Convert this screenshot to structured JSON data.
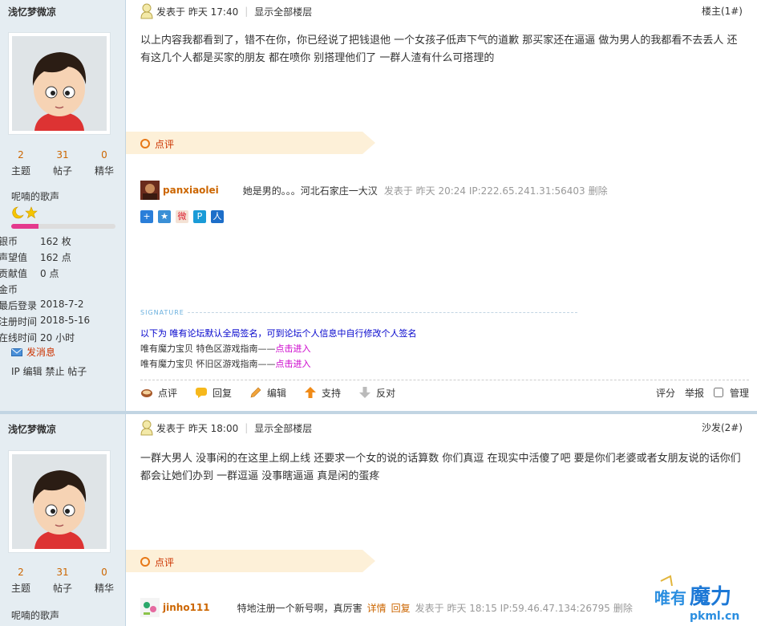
{
  "posts": [
    {
      "username": "浅忆梦微凉",
      "stats": [
        {
          "n": "2",
          "l": "主题"
        },
        {
          "n": "31",
          "l": "帖子"
        },
        {
          "n": "0",
          "l": "精华"
        }
      ],
      "group": "呢喃的歌声",
      "level_fill": 0.26,
      "profile": [
        {
          "k": "银币",
          "v": "162 枚"
        },
        {
          "k": "声望值",
          "v": "162 点"
        },
        {
          "k": "贡献值",
          "v": "0 点"
        },
        {
          "k": "金币",
          "v": ""
        },
        {
          "k": "最后登录",
          "v": "2018-7-2"
        },
        {
          "k": "注册时间",
          "v": "2018-5-16"
        },
        {
          "k": "在线时间",
          "v": "20 小时"
        }
      ],
      "pm": "发消息",
      "admin": [
        "IP",
        "编辑",
        "禁止",
        "帖子"
      ],
      "posted": "发表于 昨天 17:40",
      "show_all": "显示全部楼层",
      "floor": "楼主(1#)",
      "content": "以上内容我都看到了，错不在你，你已经说了把钱退他 一个女孩子低声下气的道歉 那买家还在逼逼 做为男人的我都看不去丢人 还有这几个人都是买家的朋友 都在喷你 别搭理他们了 一群人渣有什么可搭理的",
      "comment_label": "点评",
      "comment": {
        "user": "panxiaolei",
        "text": "她是男的。。。河北石家庄一大汉",
        "meta": "发表于 昨天 20:24 IP:222.65.241.31:56403",
        "del": "删除"
      },
      "signature_label": "SIGNATURE",
      "sig1_pre": "以下为",
      "sig1_rest": "唯有论坛默认全局签名，可到论坛个人信息中自行修改个人签名",
      "sig2": "唯有魔力宝贝 特色区游戏指南——",
      "sig3": "唯有魔力宝贝 怀旧区游戏指南——",
      "sig_link": "点击进入",
      "actions": [
        "点评",
        "回复",
        "编辑",
        "支持",
        "反对"
      ],
      "actions_right": [
        "评分",
        "举报",
        "管理"
      ]
    },
    {
      "username": "浅忆梦微凉",
      "stats": [
        {
          "n": "2",
          "l": "主题"
        },
        {
          "n": "31",
          "l": "帖子"
        },
        {
          "n": "0",
          "l": "精华"
        }
      ],
      "group": "呢喃的歌声",
      "posted": "发表于 昨天 18:00",
      "show_all": "显示全部楼层",
      "floor": "沙发(2#)",
      "content": "一群大男人 没事闲的在这里上纲上线 还要求一个女的说的话算数 你们真逗 在现实中活傻了吧 要是你们老婆或者女朋友说的话你们都会让她们办到 一群逗逼 没事瞎逼逼 真是闲的蛋疼",
      "comment_label": "点评",
      "comment": {
        "user": "jinho111",
        "text": "特地注册一个新号啊，真厉害",
        "links": [
          "详情",
          "回复"
        ],
        "meta": "发表于 昨天 18:15 IP:59.46.47.134:26795",
        "del": "删除"
      }
    }
  ],
  "watermark": {
    "logo_text": "唯有魔力",
    "domain": "pkml.cn"
  }
}
